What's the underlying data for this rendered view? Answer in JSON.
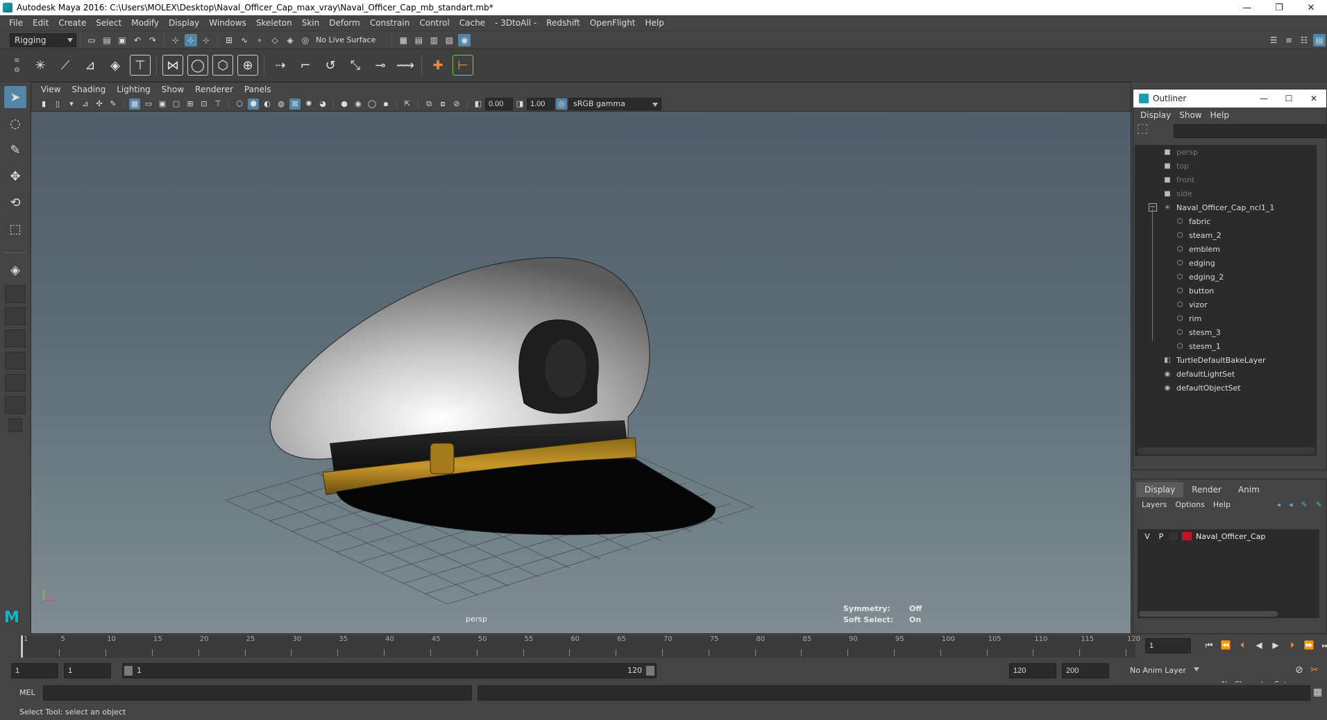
{
  "window": {
    "title": "Autodesk Maya 2016: C:\\Users\\MOLEX\\Desktop\\Naval_Officer_Cap_max_vray\\Naval_Officer_Cap_mb_standart.mb*",
    "minimize": "—",
    "restore": "❐",
    "close": "✕"
  },
  "menubar": [
    "File",
    "Edit",
    "Create",
    "Select",
    "Modify",
    "Display",
    "Windows",
    "Skeleton",
    "Skin",
    "Deform",
    "Constrain",
    "Control",
    "Cache",
    "- 3DtoAll -",
    "Redshift",
    "OpenFlight",
    "Help"
  ],
  "statusline": {
    "menuset": "Rigging",
    "live_surface": "No Live Surface"
  },
  "viewport": {
    "menu": [
      "View",
      "Shading",
      "Lighting",
      "Show",
      "Renderer",
      "Panels"
    ],
    "exposure": "0.00",
    "gamma": "1.00",
    "color_space": "sRGB gamma",
    "camera_label": "persp",
    "symmetry_label": "Symmetry:",
    "symmetry_value": "Off",
    "soft_select_label": "Soft Select:",
    "soft_select_value": "On"
  },
  "outliner": {
    "title": "Outliner",
    "menu": [
      "Display",
      "Show",
      "Help"
    ],
    "cameras": [
      "persp",
      "top",
      "front",
      "side"
    ],
    "group": "Naval_Officer_Cap_ncl1_1",
    "children": [
      "fabric",
      "steam_2",
      "emblem",
      "edging",
      "edging_2",
      "button",
      "vizor",
      "rim",
      "stesm_3",
      "stesm_1"
    ],
    "sets": [
      "TurtleDefaultBakeLayer",
      "defaultLightSet",
      "defaultObjectSet"
    ]
  },
  "layer_editor": {
    "tabs": [
      "Display",
      "Render",
      "Anim"
    ],
    "menu": [
      "Layers",
      "Options",
      "Help"
    ],
    "layer": {
      "v": "V",
      "p": "P",
      "name": "Naval_Officer_Cap",
      "color": "#c0142a"
    }
  },
  "timeline": {
    "ticks": [
      "1",
      "5",
      "10",
      "15",
      "20",
      "25",
      "30",
      "35",
      "40",
      "45",
      "50",
      "55",
      "60",
      "65",
      "70",
      "75",
      "80",
      "85",
      "90",
      "95",
      "100",
      "105",
      "110",
      "115",
      "120"
    ],
    "current_frame": "1"
  },
  "range": {
    "start": "1",
    "anim_start": "1",
    "slider_start": "1",
    "slider_end": "120",
    "anim_end": "120",
    "end": "200",
    "anim_layer": "No Anim Layer",
    "character_set": "No Character Set"
  },
  "command": {
    "lang": "MEL"
  },
  "helpline": "Select Tool: select an object",
  "colors": {
    "accent": "#5285a6",
    "viewport_top": "#4f5e6a",
    "viewport_bottom": "#7f8d92"
  }
}
